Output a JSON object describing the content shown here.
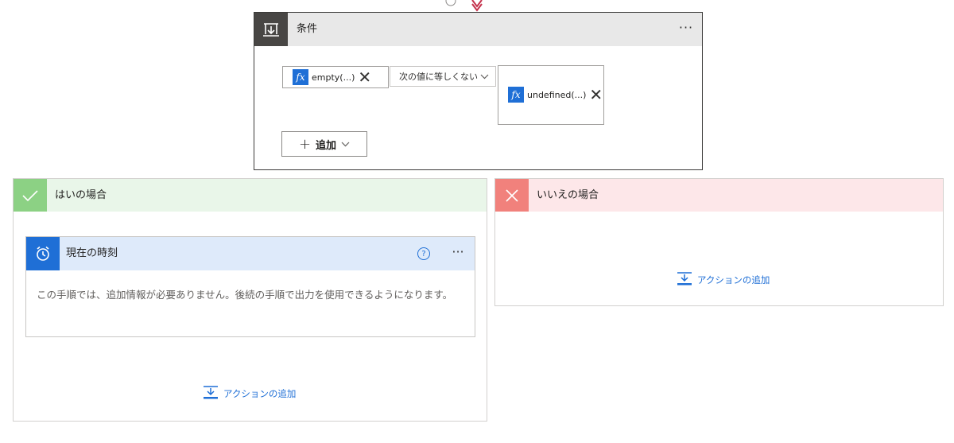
{
  "condition": {
    "title": "条件",
    "more_label": "···",
    "left_operand": "empty(...)",
    "fx_label": "fx",
    "operator": "次の値に等しくない",
    "right_operand": "undefined(...)",
    "add_label": "追加"
  },
  "yes_branch": {
    "title": "はいの場合",
    "action_card": {
      "title": "現在の時刻",
      "help_label": "?",
      "more_label": "···",
      "description": "この手順では、追加情報が必要ありません。後続の手順で出力を使用できるようになります。"
    },
    "add_action_label": "アクションの追加"
  },
  "no_branch": {
    "title": "いいえの場合",
    "add_action_label": "アクションの追加"
  },
  "icons": {
    "condition": "condition-icon",
    "check": "check-icon",
    "cross": "close-icon",
    "clock": "clock-icon",
    "add_action": "add-action-icon"
  },
  "colors": {
    "accent_blue": "#1f6fd6",
    "yes_green": "#8cd184",
    "no_red": "#f1817c",
    "condition_dark": "#484644"
  }
}
